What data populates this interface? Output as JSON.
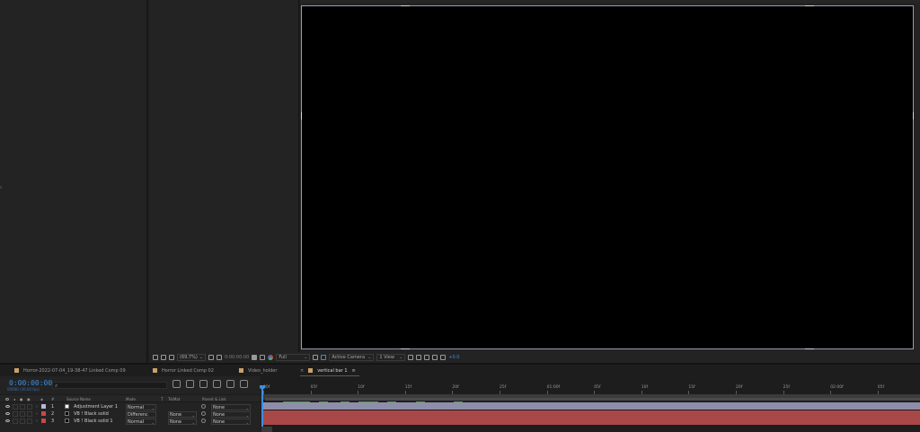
{
  "viewer_toolbar": {
    "zoom": "(69.7%)",
    "timecode": "0:00:00:00",
    "resolution": "Full",
    "camera": "Active Camera",
    "views": "1 View",
    "exposure": "+0.0"
  },
  "tabs": [
    {
      "label": "Horror-2022-07-04_19-38-47 Linked Comp 09",
      "active": false
    },
    {
      "label": "Horror Linked Comp 02",
      "active": false
    },
    {
      "label": "Video_holder",
      "active": false
    },
    {
      "label": "vertical bar 1",
      "active": true
    }
  ],
  "tab_close": "×",
  "tab_menu": "≡",
  "timeline": {
    "current_time": "0:00:00:00",
    "fps_line": "00000 (30.00 fps)",
    "columns": {
      "hash": "#",
      "source_name": "Source Name",
      "mode": "Mode",
      "t": "T",
      "trkmat": "TrkMat",
      "parent_link": "Parent & Link"
    },
    "layers": [
      {
        "num": "1",
        "name": "Adjustment Layer 1",
        "mode": "Normal",
        "trkmat": "",
        "parent": "None",
        "label_color": "#b8b8d6",
        "swatch": "#ffffff"
      },
      {
        "num": "2",
        "name": "VB ! Black solid",
        "mode": "Differenc",
        "trkmat": "None",
        "parent": "None",
        "label_color": "#c84848",
        "swatch": "#000000"
      },
      {
        "num": "3",
        "name": "VB ! Black solid 1",
        "mode": "Normal",
        "trkmat": "None",
        "parent": "None",
        "label_color": "#c84848",
        "swatch": "#000000"
      }
    ],
    "ruler_ticks": [
      "00f",
      "05f",
      "10f",
      "15f",
      "20f",
      "25f",
      "01:00f",
      "05f",
      "10f",
      "15f",
      "20f",
      "25f",
      "02:00f",
      "05f"
    ]
  },
  "colors": {
    "accent_blue": "#3d8ee0",
    "adjustment_track": "#8e8eab",
    "solid_track": "#a84848",
    "marker_green": "#4aa040",
    "tab_swatch": "#c8a26a"
  }
}
